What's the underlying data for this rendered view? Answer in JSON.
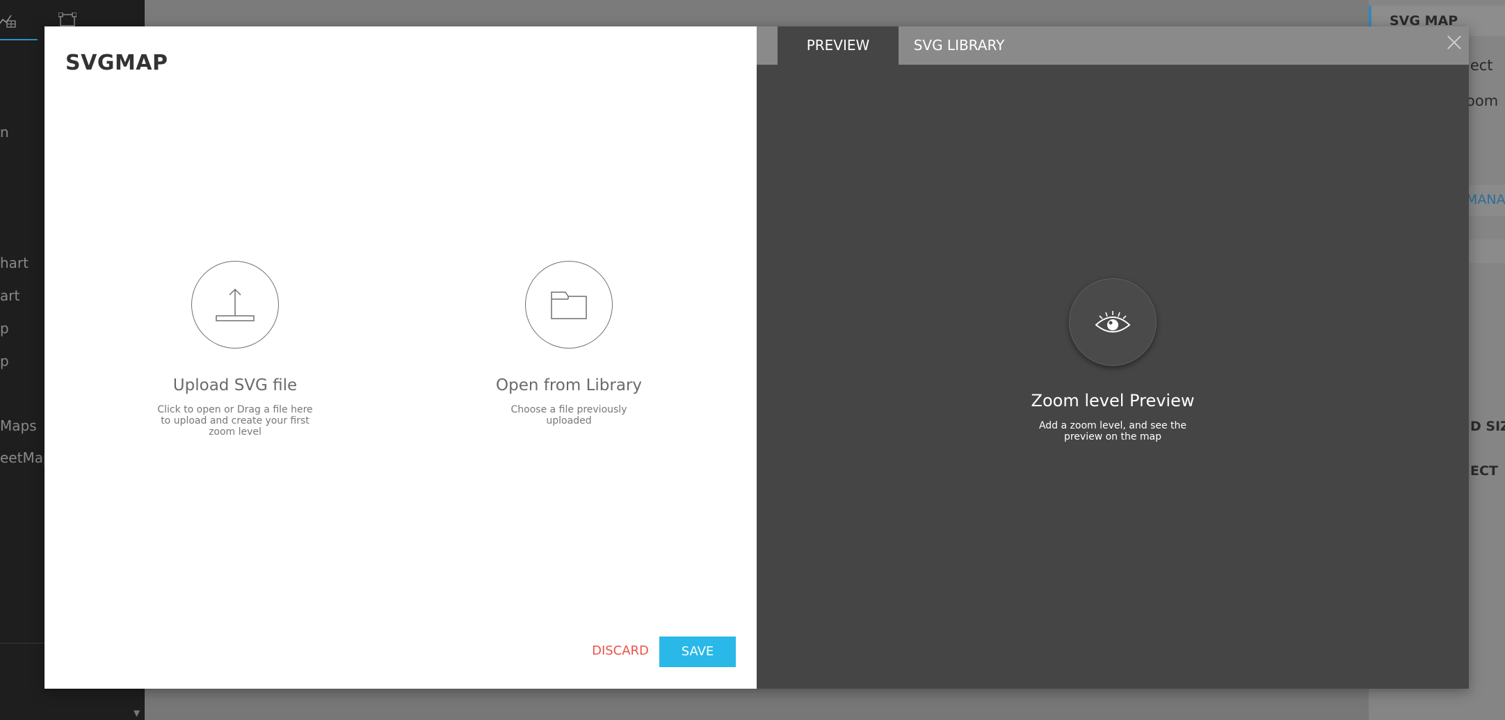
{
  "background": {
    "sidebar_items": [
      "n",
      "hart",
      "art",
      "p",
      "p",
      "Maps",
      "eetMap"
    ],
    "right_panel": {
      "header": "SVG MAP",
      "text_1": "ject",
      "text_2": "oom",
      "link": "MANA",
      "label_1": "D SIZE",
      "label_2": "ECT"
    }
  },
  "modal": {
    "title": "SVGMAP",
    "upload": {
      "icon": "upload-icon",
      "label": "Upload SVG file",
      "description": "Click to open or Drag a file here to upload and create your first zoom level"
    },
    "library": {
      "icon": "folder-icon",
      "label": "Open from Library",
      "description": "Choose a file previously uploaded"
    },
    "discard_label": "DISCARD",
    "save_label": "SAVE",
    "colors": {
      "save": "#29b8e8",
      "discard": "#e8524a",
      "dark_panel": "#454545"
    }
  },
  "preview_panel": {
    "tabs": [
      {
        "label": "PREVIEW",
        "active": true
      },
      {
        "label": "SVG LIBRARY",
        "active": false
      }
    ],
    "icon": "eye-icon",
    "title": "Zoom level Preview",
    "description": "Add a zoom level, and see the preview on the map"
  }
}
